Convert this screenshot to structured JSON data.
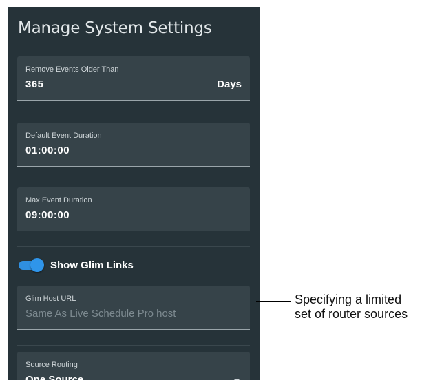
{
  "panel": {
    "title": "Manage System Settings",
    "remove_events": {
      "label": "Remove Events Older Than",
      "value": "365",
      "suffix": "Days"
    },
    "default_duration": {
      "label": "Default Event Duration",
      "value": "01:00:00"
    },
    "max_duration": {
      "label": "Max Event Duration",
      "value": "09:00:00"
    },
    "glim_links": {
      "label": "Show Glim Links",
      "enabled": true
    },
    "glim_host": {
      "label": "Glim Host URL",
      "placeholder": "Same As Live Schedule Pro host"
    },
    "source_routing": {
      "label": "Source Routing",
      "value": "One Source"
    }
  },
  "callout": {
    "line1": "Specifying a limited",
    "line2": "set of router sources"
  },
  "colors": {
    "panel_bg": "#263339",
    "field_bg": "#364349",
    "toggle_accent": "#2f95ea"
  }
}
